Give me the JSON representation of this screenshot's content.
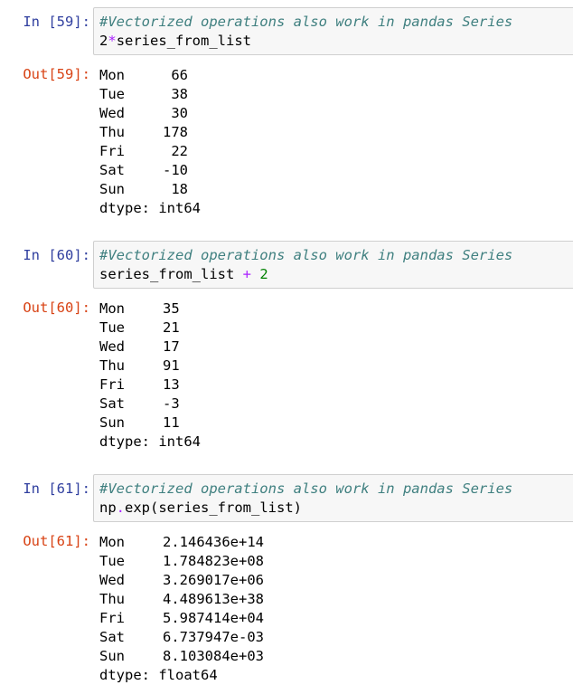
{
  "cells": [
    {
      "in_prompt": "In [59]:",
      "comment": "#Vectorized operations also work in pandas Series",
      "code": {
        "prefix": "2",
        "op": "*",
        "rest": "series_from_list"
      },
      "out_prompt": "Out[59]:",
      "rows": [
        {
          "index": "Mon",
          "value": "66"
        },
        {
          "index": "Tue",
          "value": "38"
        },
        {
          "index": "Wed",
          "value": "30"
        },
        {
          "index": "Thu",
          "value": "178"
        },
        {
          "index": "Fri",
          "value": "22"
        },
        {
          "index": "Sat",
          "value": "-10"
        },
        {
          "index": "Sun",
          "value": "18"
        }
      ],
      "dtype": "dtype: int64"
    },
    {
      "in_prompt": "In [60]:",
      "comment": "#Vectorized operations also work in pandas Series",
      "code": {
        "prefix": "series_from_list ",
        "op": "+",
        "rest": " 2"
      },
      "out_prompt": "Out[60]:",
      "rows": [
        {
          "index": "Mon",
          "value": "35"
        },
        {
          "index": "Tue",
          "value": "21"
        },
        {
          "index": "Wed",
          "value": "17"
        },
        {
          "index": "Thu",
          "value": "91"
        },
        {
          "index": "Fri",
          "value": "13"
        },
        {
          "index": "Sat",
          "value": "-3"
        },
        {
          "index": "Sun",
          "value": "11"
        }
      ],
      "dtype": "dtype: int64"
    },
    {
      "in_prompt": "In [61]:",
      "comment": "#Vectorized operations also work in pandas Series",
      "code": {
        "prefix": "np",
        "op": ".",
        "rest": "exp(series_from_list)"
      },
      "out_prompt": "Out[61]:",
      "rows": [
        {
          "index": "Mon",
          "value": "2.146436e+14"
        },
        {
          "index": "Tue",
          "value": "1.784823e+08"
        },
        {
          "index": "Wed",
          "value": "3.269017e+06"
        },
        {
          "index": "Thu",
          "value": "4.489613e+38"
        },
        {
          "index": "Fri",
          "value": "5.987414e+04"
        },
        {
          "index": "Sat",
          "value": "6.737947e-03"
        },
        {
          "index": "Sun",
          "value": "8.103084e+03"
        }
      ],
      "dtype": "dtype: float64"
    }
  ],
  "colors": {
    "in_prompt": "#303f9f",
    "out_prompt": "#d84315",
    "comment": "#408080",
    "operator": "#aa22ff",
    "number": "#008000"
  }
}
